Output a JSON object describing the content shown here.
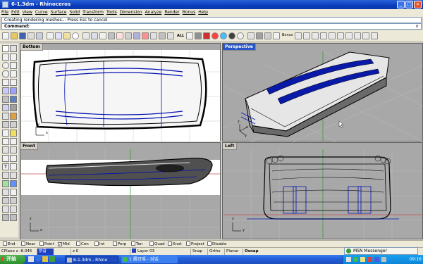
{
  "window": {
    "title": "6-1.3dm - Rhinoceros",
    "minimize_glyph": "_",
    "maximize_glyph": "□",
    "close_glyph": "×",
    "accent": "#0a3dbd"
  },
  "menu": [
    "File",
    "Edit",
    "View",
    "Curve",
    "Surface",
    "Solid",
    "Transform",
    "Tools",
    "Dimension",
    "Analyze",
    "Render",
    "Bonus",
    "Help"
  ],
  "command": {
    "history": "Creating rendering meshes... Press Esc to cancel",
    "prompt": "Command:",
    "close_glyph": "×"
  },
  "toolbar": {
    "all_label": "ALL",
    "bonus_label": "Bonus"
  },
  "viewports": {
    "top_left": {
      "title": "Bottom",
      "axis_x": "x",
      "axis_y": "y"
    },
    "top_right": {
      "title": "Perspective",
      "axis_x": "x",
      "axis_y": "y",
      "axis_z": "z"
    },
    "bottom_left": {
      "title": "Front",
      "axis_x": "x",
      "axis_z": "z"
    },
    "bottom_right": {
      "title": "Left",
      "axis_y": "y",
      "axis_z": "z"
    }
  },
  "osnap": [
    {
      "label": "End",
      "checked": false
    },
    {
      "label": "Near",
      "checked": false
    },
    {
      "label": "Point",
      "checked": false
    },
    {
      "label": "Mid",
      "checked": true
    },
    {
      "label": "Cen",
      "checked": false
    },
    {
      "label": "Int",
      "checked": false
    },
    {
      "label": "Perp",
      "checked": false
    },
    {
      "label": "Tan",
      "checked": false
    },
    {
      "label": "Quad",
      "checked": false
    },
    {
      "label": "Knot",
      "checked": false
    },
    {
      "label": "Project",
      "checked": false
    },
    {
      "label": "Disable",
      "checked": false
    }
  ],
  "status": {
    "cplane": "CPlane x -6.045",
    "ime_label": "拼音",
    "z": "z 0",
    "layer": "Layer 03",
    "layer_color": "#1f3fbf",
    "snap": "Snap",
    "ortho": "Ortho",
    "planar": "Planar",
    "osnap": "Osnap"
  },
  "taskbar": {
    "start": "开始",
    "tasks": [
      {
        "label": "6-1.3dm - Rhino"
      },
      {
        "label": "1 晨日瑶 - 对话"
      }
    ],
    "msn": "MSN Messenger",
    "clock": "09:16"
  },
  "colors": {
    "model_blue": "#0010b0",
    "viewport_bg": "#a8a8a8",
    "grid_line": "#9a9a9a"
  }
}
